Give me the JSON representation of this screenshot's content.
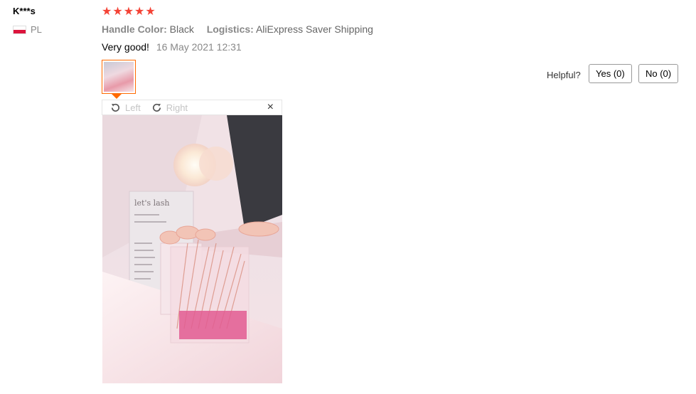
{
  "review": {
    "user_name": "K***s",
    "country_code": "PL",
    "rating_stars": 5,
    "attributes": [
      {
        "label": "Handle Color:",
        "value": "Black"
      },
      {
        "label": "Logistics:",
        "value": "AliExpress Saver Shipping"
      }
    ],
    "feedback_text": "Very good!",
    "date": "16 May 2021 12:31"
  },
  "viewer": {
    "rotate_left_label": "Left",
    "rotate_right_label": "Right",
    "close_symbol": "×",
    "photo_text": "let's lash"
  },
  "helpful": {
    "label": "Helpful?",
    "yes_label": "Yes (0)",
    "no_label": "No (0)"
  },
  "colors": {
    "star": "#f44336",
    "thumbnail_border": "#ff6a00"
  }
}
